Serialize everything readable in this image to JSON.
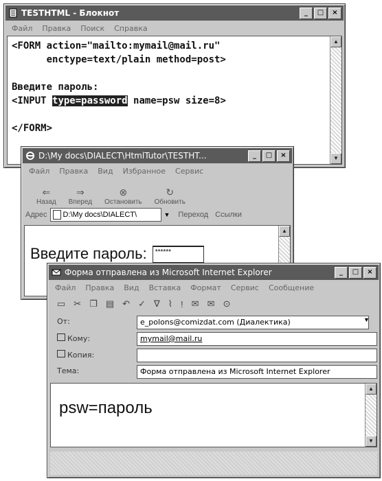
{
  "notepad": {
    "title": "TESTHTML - Блокнот",
    "menu": [
      "Файл",
      "Правка",
      "Поиск",
      "Справка"
    ],
    "code_lines": [
      "<FORM action=\"mailto:mymail@mail.ru\"",
      "      enctype=text/plain method=post>",
      "",
      "Введите пароль:"
    ],
    "line5_prefix": "<INPUT ",
    "line5_highlight": "type=password",
    "line5_suffix": " name=psw size=8>",
    "line7": "</FORM>"
  },
  "ie": {
    "title": "D:\\My docs\\DIALECT\\HtmlTutor\\TESTHT...",
    "menu": [
      "Файл",
      "Правка",
      "Вид",
      "Избранное",
      "Сервис"
    ],
    "toolbar": {
      "back": "Назад",
      "forward": "Вперед",
      "stop": "Остановить",
      "refresh": "Обновить"
    },
    "address_label": "Адрес",
    "address_value": "D:\\My docs\\DIALECT\\",
    "go_label": "Переход",
    "links_label": "Ссылки",
    "prompt": "Введите пароль:",
    "password_value": "******"
  },
  "mail": {
    "title": "Форма отправлена из Microsoft Internet Explorer",
    "menu": [
      "Файл",
      "Правка",
      "Вид",
      "Вставка",
      "Формат",
      "Сервис",
      "Сообщение"
    ],
    "from_label": "От:",
    "from_value": "e_polons@comizdat.com   (Диалектика)",
    "to_label": "Кому:",
    "to_value": "mymail@mail.ru",
    "cc_label": "Копия:",
    "cc_value": "",
    "subject_label": "Тема:",
    "subject_value": "Форма отправлена из Microsoft Internet Explorer",
    "body": "psw=пароль"
  }
}
